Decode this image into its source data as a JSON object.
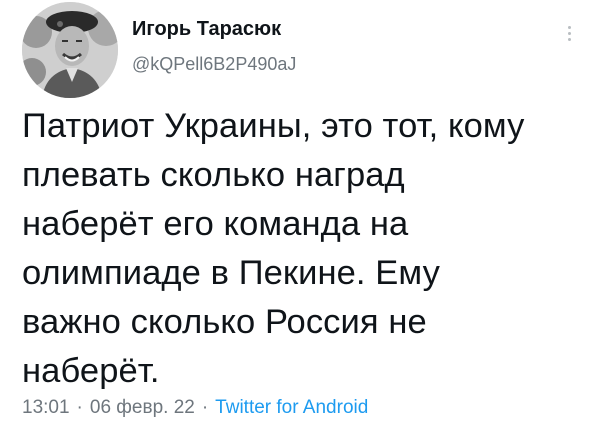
{
  "user": {
    "display_name": "Игорь Тарасюк",
    "handle": "@kQPell6B2P490aJ"
  },
  "tweet": {
    "text": "Патриот Украины, это тот, кому\nплевать сколько наград\nнаберёт его  команда на\nолимпиаде в Пекине. Ему\nважно сколько Россия не\nнаберёт."
  },
  "meta": {
    "time": "13:01",
    "date": "06 февр. 22",
    "separator": "·",
    "source": "Twitter for Android"
  },
  "icons": {
    "more": "more-vertical-icon",
    "avatar": "avatar"
  },
  "colors": {
    "text": "#0f1419",
    "secondary": "#6e767d",
    "link": "#1d9bf0"
  }
}
